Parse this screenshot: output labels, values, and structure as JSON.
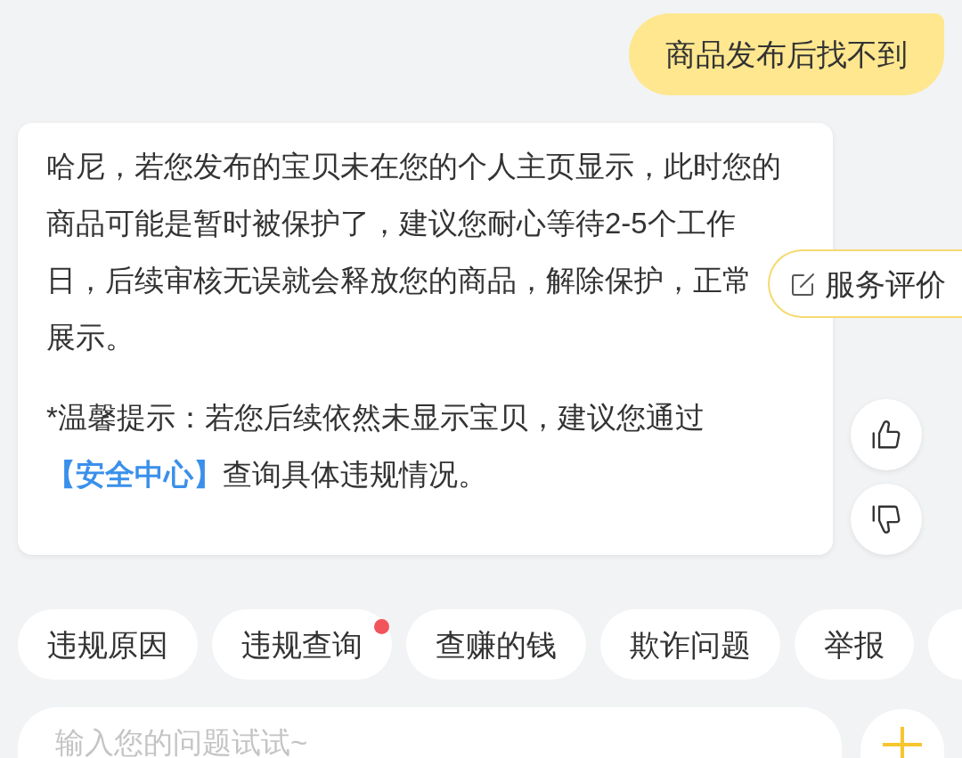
{
  "user_message": {
    "text": "商品发布后找不到"
  },
  "reply": {
    "text": "哈尼，若您发布的宝贝未在您的个人主页显示，此时您的商品可能是暂时被保护了，建议您耐心等待2-5个工作日，后续审核无误就会释放您的商品，解除保护，正常展示。",
    "tip": {
      "text_before": "*温馨提示：若您后续依然未显示宝贝，建议您通过",
      "link": "【安全中心】",
      "text_after": "查询具体违规情况。"
    }
  },
  "rating_button": {
    "label": "服务评价"
  },
  "quick_replies": {
    "items": [
      {
        "label": "违规原因",
        "dot": false
      },
      {
        "label": "违规查询",
        "dot": true
      },
      {
        "label": "查赚的钱",
        "dot": false
      },
      {
        "label": "欺诈问题",
        "dot": false
      },
      {
        "label": "举报",
        "dot": false
      }
    ],
    "more_cut_off": true
  },
  "input": {
    "placeholder": "输入您的问题试试~"
  }
}
